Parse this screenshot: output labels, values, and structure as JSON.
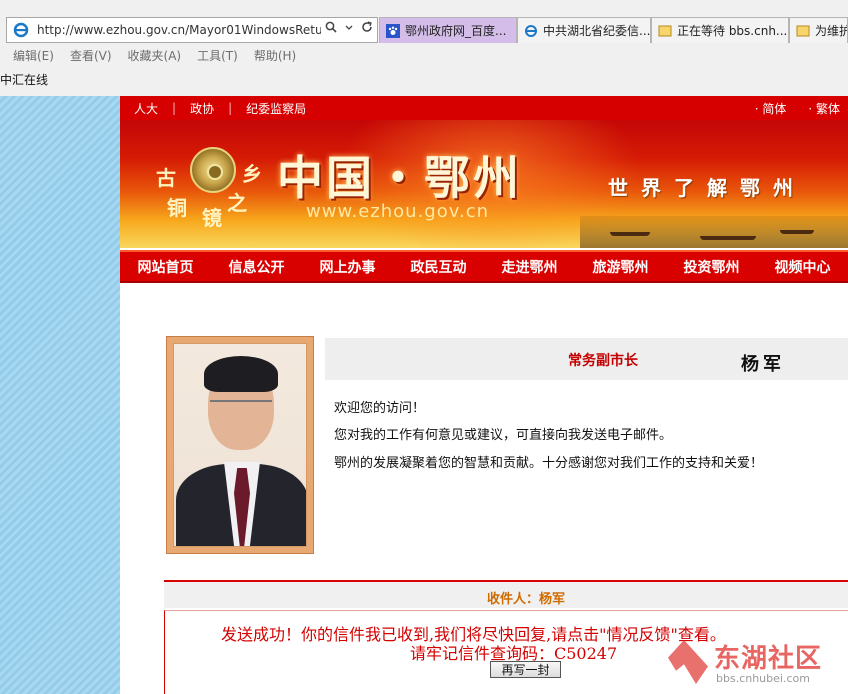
{
  "browser": {
    "url": "http://www.ezhou.gov.cn/Mayor01WindowsRetur",
    "tabs": [
      {
        "label": "鄂州政府网_百度...",
        "active": true
      },
      {
        "label": "中共湖北省纪委信...",
        "active": false
      },
      {
        "label": "正在等待 bbs.cnh...",
        "active": false
      },
      {
        "label": "为维护",
        "active": false
      }
    ],
    "menu": [
      "编辑(E)",
      "查看(V)",
      "收藏夹(A)",
      "工具(T)",
      "帮助(H)"
    ],
    "favorites": [
      "中汇在线"
    ]
  },
  "top_links": {
    "left": [
      "人大",
      "政协",
      "纪委监察局"
    ],
    "right": [
      "简体",
      "繁体"
    ]
  },
  "banner": {
    "ancient_chars": [
      "古",
      "乡",
      "铜",
      "镜",
      "之"
    ],
    "title": "中国・鄂州",
    "site": "www.ezhou.gov.cn",
    "slogan": "世界了解鄂州"
  },
  "nav": [
    "网站首页",
    "信息公开",
    "网上办事",
    "政民互动",
    "走进鄂州",
    "旅游鄂州",
    "投资鄂州",
    "视频中心"
  ],
  "profile": {
    "role": "常务副市长",
    "name": "杨军",
    "greeting": [
      "欢迎您的访问！",
      "您对我的工作有何意见或建议，可直接向我发送电子邮件。",
      "鄂州的发展凝聚着您的智慧和贡献。十分感谢您对我们工作的支持和关爱！"
    ]
  },
  "recipient": {
    "label": "收件人：杨军"
  },
  "result": {
    "line1": "发送成功！你的信件我已收到,我们将尽快回复,请点击\"情况反馈\"查看。",
    "line2": "请牢记信件查询码：C50247",
    "button": "再写一封"
  },
  "watermark": {
    "text": "东湖社区",
    "sub": "bbs.cnhubei.com"
  },
  "colors": {
    "accent_red": "#d60000",
    "tab_active": "#d4bde8",
    "message_red": "#d40000",
    "recipient_orange": "#d06b00"
  }
}
